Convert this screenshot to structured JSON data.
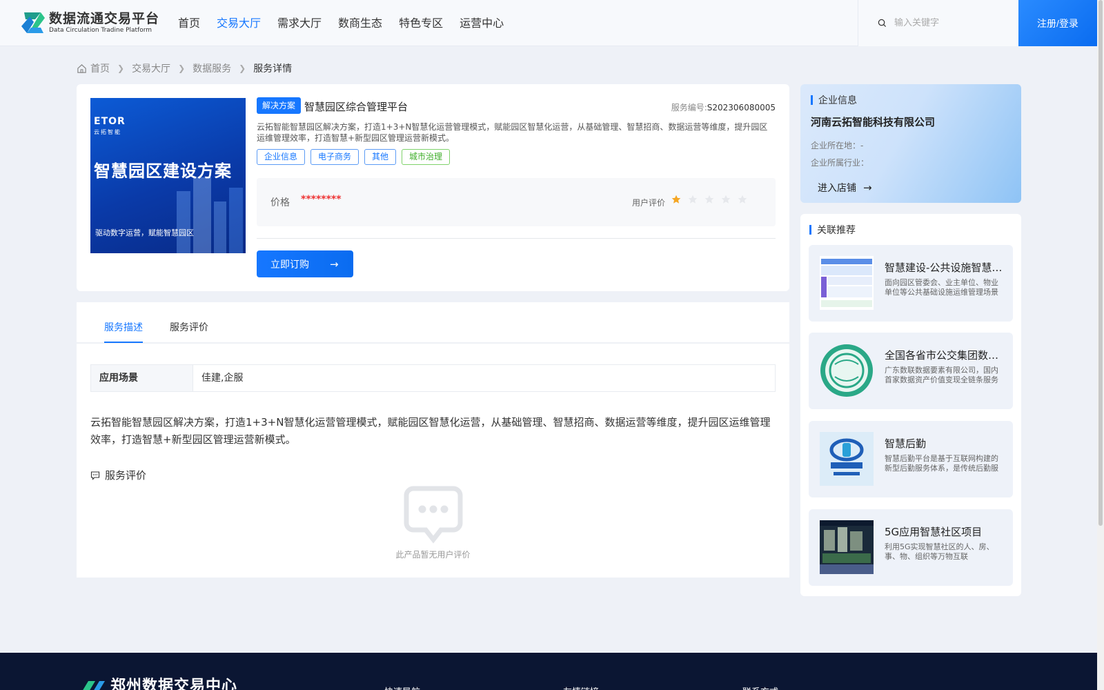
{
  "header": {
    "logo_title": "数据流通交易平台",
    "logo_sub": "Data Circulation Tradine Platform",
    "nav": [
      "首页",
      "交易大厅",
      "需求大厅",
      "数商生态",
      "特色专区",
      "运营中心"
    ],
    "nav_active_index": 1,
    "search_placeholder": "输入关键字",
    "login_label": "注册/登录"
  },
  "breadcrumb": {
    "items": [
      "首页",
      "交易大厅",
      "数据服务"
    ],
    "current": "服务详情"
  },
  "product": {
    "cover_brand": "ETOR",
    "cover_brand_sub": "云拓智能",
    "cover_title": "智慧园区建设方案",
    "cover_caption": "驱动数字运营，赋能智慧园区",
    "type_tag": "解决方案",
    "title": "智慧园区综合管理平台",
    "service_no_label": "服务编号:",
    "service_no": "S202306080005",
    "description": "云拓智能智慧园区解决方案，打造1+3+N智慧化运营管理模式，赋能园区智慧化运营，从基础管理、智慧招商、数据运营等维度，提升园区运维管理效率，打造智慧+新型园区管理运营新模式。",
    "tags": [
      {
        "label": "企业信息",
        "color": "blue"
      },
      {
        "label": "电子商务",
        "color": "blue"
      },
      {
        "label": "其他",
        "color": "blue"
      },
      {
        "label": "城市治理",
        "color": "green"
      }
    ],
    "price_label": "价格",
    "price_value": "********",
    "rating_label": "用户评价",
    "rating": 1,
    "rating_max": 5,
    "buy_label": "立即订购"
  },
  "detail": {
    "tabs": [
      "服务描述",
      "服务评价"
    ],
    "active_tab": 0,
    "scene_label": "应用场景",
    "scene_value": "佳建,企服",
    "long_description": "云拓智能智慧园区解决方案，打造1+3+N智慧化运营管理模式，赋能园区智慧化运营，从基础管理、智慧招商、数据运营等维度，提升园区运维管理效率，打造智慧+新型园区管理运营新模式。",
    "review_heading": "服务评价",
    "empty_text": "此产品暂无用户评价"
  },
  "company": {
    "heading": "企业信息",
    "name": "河南云拓智能科技有限公司",
    "location_label": "企业所在地：",
    "location_value": "-",
    "industry_label": "企业所属行业：",
    "industry_value": "",
    "enter_label": "进入店铺"
  },
  "recommend": {
    "heading": "关联推荐",
    "items": [
      {
        "title": "智慧建设-公共设施智慧运维平台",
        "desc": "面向园区管委会、业主单位、物业单位等公共基础设施运维管理场景"
      },
      {
        "title": "全国各省市公交集团数据资产价值变现",
        "desc": "广东数联数据要素有限公司，国内首家数据资产价值变现全链条服务商"
      },
      {
        "title": "智慧后勤",
        "desc": "智慧后勤平台是基于互联网构建的新型后勤服务体系，是传统后勤服务的升级"
      },
      {
        "title": "5G应用智慧社区项目",
        "desc": "利用5G实现智慧社区的人、房、事、物、组织等万物互联"
      }
    ]
  },
  "footer": {
    "title": "郑州数据交易中心",
    "columns": [
      "快速导航",
      "友情链接",
      "联系方式"
    ]
  },
  "colors": {
    "primary": "#1677ff",
    "price": "#e33333",
    "star_on": "#f5a623",
    "star_off": "#e6e8ec",
    "footer_bg": "#0b1633",
    "green_tag": "#3fae2a"
  }
}
